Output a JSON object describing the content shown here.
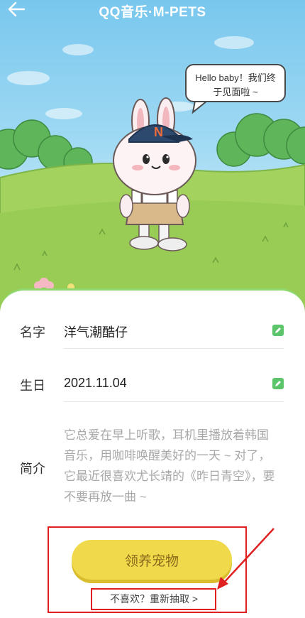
{
  "header": {
    "title": "QQ音乐·M-PETS",
    "back_icon": "arrow-left-icon"
  },
  "pet": {
    "speech": "Hello baby！我们终于见面啦 ~",
    "cap_letter": "N"
  },
  "profile": {
    "name_label": "名字",
    "name_value": "洋气潮酷仔",
    "birthday_label": "生日",
    "birthday_value": "2021.11.04",
    "intro_label": "简介",
    "intro_text": "它总爱在早上听歌，耳机里播放着韩国音乐，用咖啡唤醒美好的一天 ~ 对了，它最近很喜欢尤长靖的《昨日青空》，要不要再放一曲 ~",
    "edit_icon": "edit-icon"
  },
  "actions": {
    "adopt_label": "领养宠物",
    "redraw_label": "不喜欢？重新抽取 >"
  },
  "colors": {
    "accent_green": "#5cc46a",
    "button_yellow": "#f0d94a",
    "annotation_red": "#e02020"
  }
}
